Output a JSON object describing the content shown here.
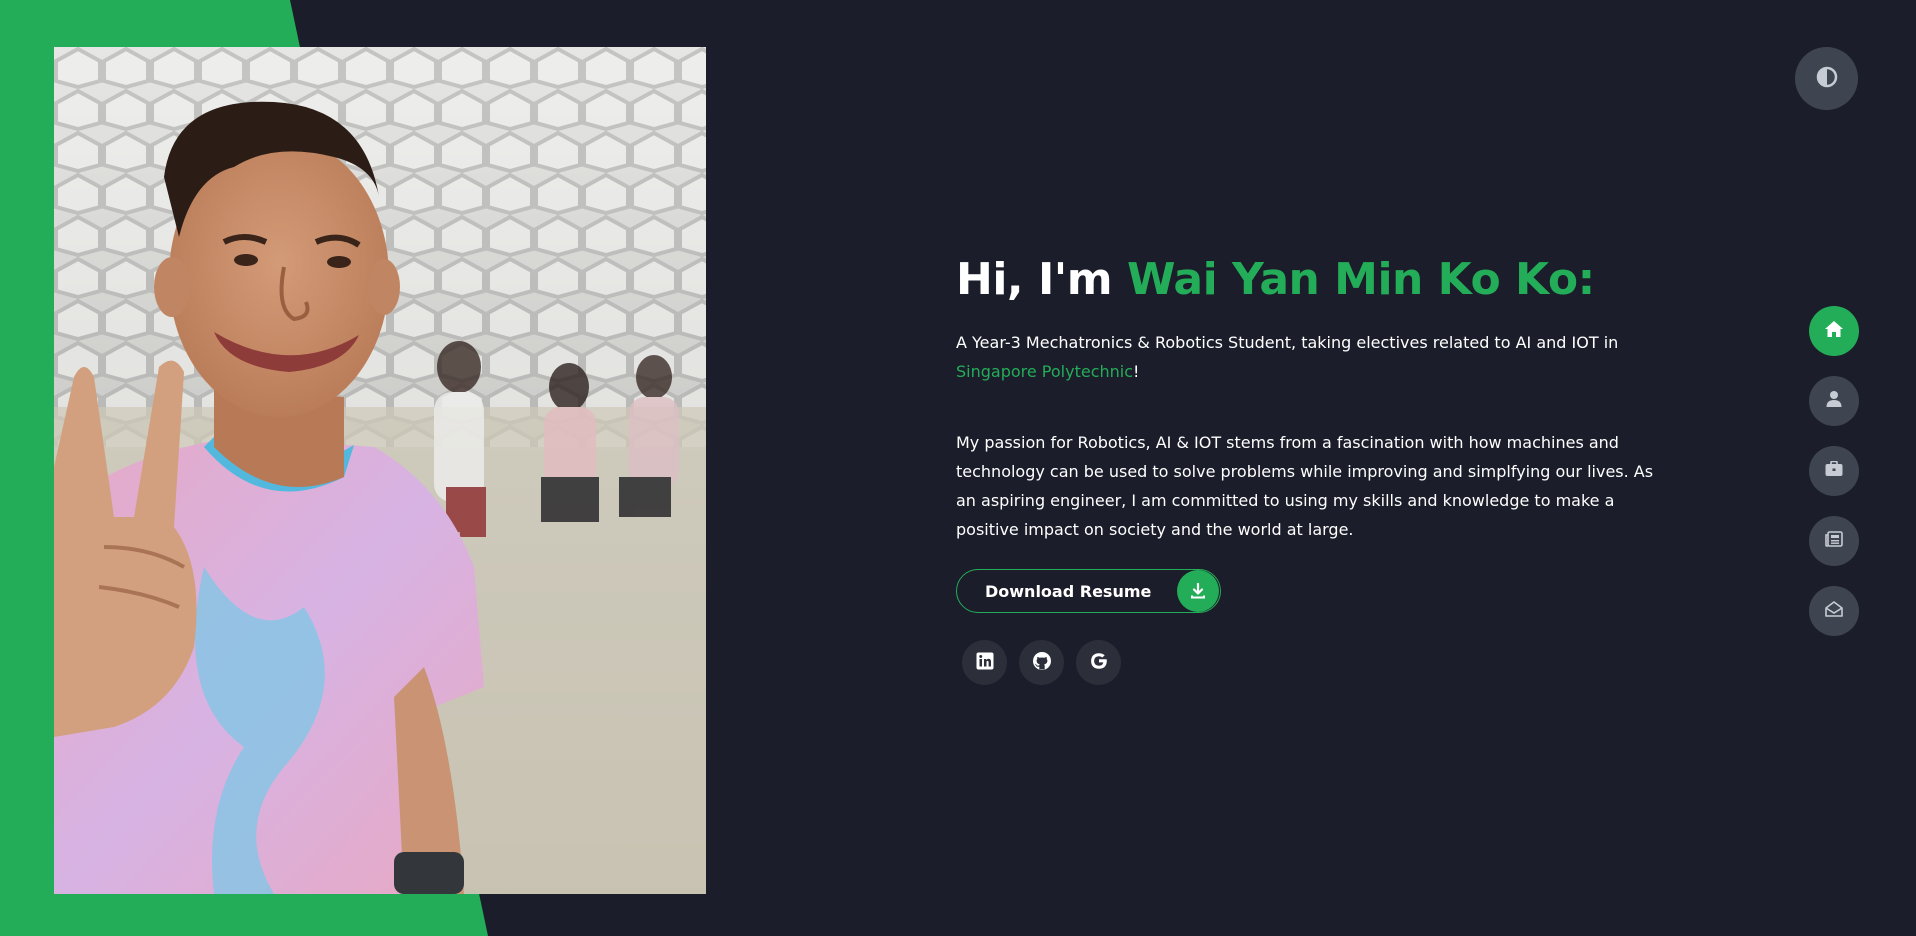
{
  "hero": {
    "greeting": "Hi, I'm ",
    "name": "Wai Yan Min Ko Ko:",
    "intro_text": "A Year-3 Mechatronics & Robotics Student, taking electives related to AI and IOT in ",
    "school": "Singapore Polytechnic",
    "intro_suffix": "!",
    "passion": "My passion for Robotics, AI & IOT stems from a fascination with how machines and technology can be used to solve problems while improving and simplfying our lives. As an aspiring engineer, I am committed to using my skills and knowledge to make a positive impact on society and the world at large.",
    "resume_label": "Download Resume"
  },
  "icons": {
    "theme_toggle": "contrast-icon",
    "download": "download-icon",
    "socials": [
      "linkedin-icon",
      "github-icon",
      "google-icon"
    ],
    "nav": [
      "home-icon",
      "user-icon",
      "briefcase-icon",
      "newspaper-icon",
      "envelope-open-icon"
    ]
  },
  "nav": {
    "active_index": 0
  },
  "colors": {
    "accent": "#24ad58",
    "background": "#1b1d2a",
    "nav_button": "#3f4550",
    "social_button": "#2c2f3a",
    "text": "#ffffff"
  }
}
